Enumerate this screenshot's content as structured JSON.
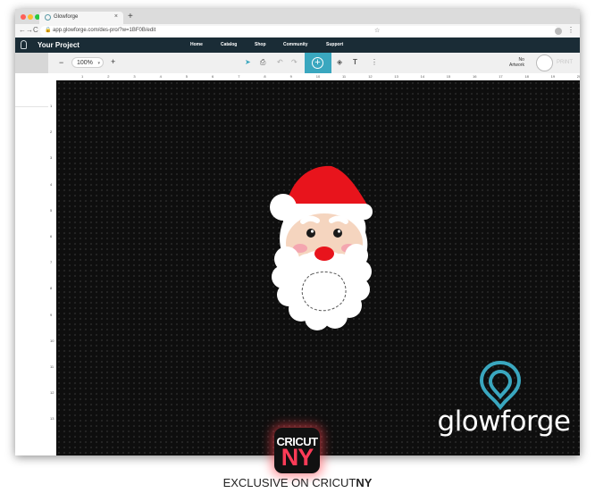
{
  "browser": {
    "tab_title": "Glowforge",
    "tab_close": "×",
    "new_tab": "+",
    "url": "app.glowforge.com/des-pro/?w=1BF0B/edit",
    "back": "←",
    "forward": "→",
    "reload": "C"
  },
  "app_nav": {
    "project_title": "Your Project",
    "links": [
      "Home",
      "Catalog",
      "Shop",
      "Community",
      "Support"
    ]
  },
  "toolbar": {
    "zoom_out": "−",
    "zoom_value": "100%",
    "zoom_in": "+",
    "status_line1": "No",
    "status_line2": "Artwork",
    "print_label": "PRINT"
  },
  "ruler": {
    "horizontal": [
      "1",
      "2",
      "3",
      "4",
      "5",
      "6",
      "7",
      "8",
      "9",
      "10",
      "11",
      "12",
      "13",
      "14",
      "15",
      "16",
      "17",
      "18",
      "19",
      "20"
    ],
    "vertical": [
      "1",
      "2",
      "3",
      "4",
      "5",
      "6",
      "7",
      "8",
      "9",
      "10",
      "11",
      "12",
      "13"
    ]
  },
  "watermark": {
    "brand": "glowforge",
    "accent_color": "#3aa7bf"
  },
  "badge": {
    "line1": "CRICUT",
    "line2": "NY",
    "accent_color": "#ff3b57"
  },
  "caption": {
    "prefix": "EXCLUSIVE ON CRICUT",
    "suffix": "NY"
  }
}
